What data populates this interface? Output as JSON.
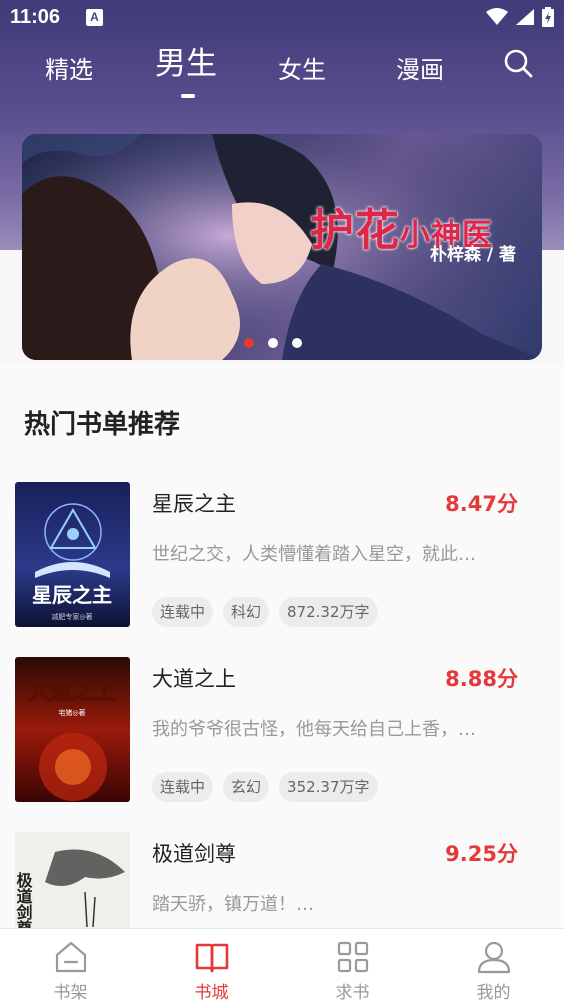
{
  "status_bar": {
    "time": "11:06",
    "notification_badge": "A"
  },
  "top_tabs": [
    {
      "label": "精选",
      "active": false
    },
    {
      "label": "男生",
      "active": true
    },
    {
      "label": "女生",
      "active": false
    },
    {
      "label": "漫画",
      "active": false
    }
  ],
  "banner": {
    "title_main": "护花",
    "title_small": "小神医",
    "author": "朴梓森 / 著",
    "slide_count": 3,
    "active_slide": 1
  },
  "section_title": "热门书单推荐",
  "books": [
    {
      "name": "星辰之主",
      "score": "8.47分",
      "desc": "世纪之交，人类懵懂着踏入星空，就此…",
      "tags": [
        "连载中",
        "科幻",
        "872.32万字"
      ],
      "cover_title": "星辰之主",
      "cover_author": "减肥专家◎著"
    },
    {
      "name": "大道之上",
      "score": "8.88分",
      "desc": "我的爷爷很古怪，他每天给自己上香，…",
      "tags": [
        "连载中",
        "玄幻",
        "352.37万字"
      ],
      "cover_title": "大道之上",
      "cover_author": "宅猪◎著"
    },
    {
      "name": "极道剑尊",
      "score": "9.25分",
      "desc": "踏天骄，镇万道！…",
      "tags": [],
      "cover_title": "极道剑尊",
      "cover_author": ""
    }
  ],
  "bottom_nav": [
    {
      "label": "书架",
      "icon": "bookshelf-icon",
      "active": false
    },
    {
      "label": "书城",
      "icon": "book-open-icon",
      "active": true
    },
    {
      "label": "求书",
      "icon": "grid-icon",
      "active": false
    },
    {
      "label": "我的",
      "icon": "user-icon",
      "active": false
    }
  ],
  "colors": {
    "accent": "#e5383b",
    "header_purple": "#4a4483",
    "muted_text": "#999999"
  }
}
